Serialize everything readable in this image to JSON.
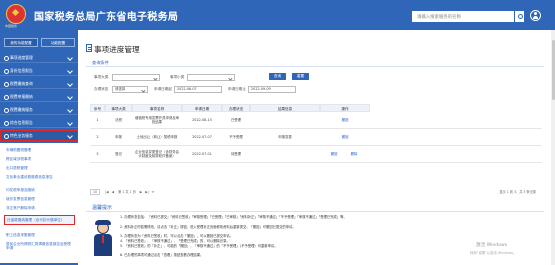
{
  "header": {
    "title": "国家税务总局广东省电子税务局",
    "logo_sub": "中国税务",
    "search_placeholder": "请输入搜索服务的名称"
  },
  "sidebar": {
    "tabs": [
      "我的功能配置",
      "功能配置"
    ],
    "items": [
      "事项进度管理",
      "身份信息报告",
      "税费缴纳查询",
      "税费申报缴纳",
      "税费缴纳服务",
      "综合信息报告",
      "特色业务服务"
    ],
    "highlighted_index": 6,
    "subitems": [
      "车辆购置税管理",
      "跨区域涉税事项",
      "出口退税管理",
      "文化事业建设费缴费信息报告",
      "印花税申报及缴纳",
      "境外发票信息管理",
      "非正常户解除申请",
      "社保费缴纳管理（含代扣代缴单位）",
      "职工信息采集管理",
      "居民企业所得税汇算清缴信息报告及受理申请"
    ],
    "active_subitem_index": 6
  },
  "main": {
    "page_title": "事项进度管理",
    "section_title": "查询条件",
    "filters": {
      "type_label": "事项大类",
      "type_value": "",
      "subtype_label": "事项小类",
      "subtype_value": "",
      "status_label": "办理状态",
      "status_value": "请选择",
      "start_label": "申请日期起",
      "start_value": "2022-06-07",
      "end_label": "申请日期止",
      "end_value": "2022-09-09"
    },
    "buttons": {
      "query": "查询",
      "reset": "重置"
    },
    "table": {
      "headers": [
        "序号",
        "事项大类",
        "事项名称",
        "申请日期",
        "办理状态",
        "结果信息",
        "操作"
      ],
      "rows": [
        {
          "no": "1",
          "category": "法税",
          "name": "增值税专用发票开具申请及审批结果",
          "date": "2022-08-15",
          "status": "已受理",
          "result": "",
          "actions": [
            "撤回"
          ]
        },
        {
          "no": "2",
          "category": "申报",
          "name": "土地出让（转让）契税申报",
          "date": "2022-07-07",
          "status": "不予受理",
          "result": "申报变更",
          "actions": [
            "撤回"
          ]
        },
        {
          "no": "3",
          "category": "登记",
          "name": "企业信息变更登记（含财务会计制度及核算软件备案）",
          "date": "2022-07-01",
          "status": "待受理",
          "result": "",
          "actions": [
            "撤回",
            "删除"
          ]
        }
      ]
    },
    "pager": {
      "page_size": "10",
      "page_text": "第 1 共 1 页",
      "summary": "显示 1 到 3，共 3 条记录"
    },
    "hint": {
      "title": "温馨提示",
      "lines": [
        "1. 办理状态包括：「资料已提交」「资料已签收」「审核受理」「已受理」「已审核」「资料补正」「审核不通过」「不予受理」「审核不通过」「受理已完成」等。",
        "2. 资料补正时若需修改，请点击「补正」按钮，进入受理补正页面修改资料后重新提交；「撤回」可撤回已提交的申请。",
        "3. 办理状态为「资料已签收」时，可以点击「撤回」，可以撤回已提交申请。",
        "4. 「资料已签收」、「审核不通过」、「受理已完成」的，可以删除记录。",
        "5. 「资料已签收」的「补正」、可能的「撤回」、「审核不通过」的「不予受理」（不予受理）可重新申请。",
        "6. 已办理的事项可通过点击「查看」按钮查看办理结果。"
      ]
    }
  },
  "watermark": {
    "line1": "激活 Windows",
    "line2": "转到\"设置\"以激活 Windows。"
  },
  "colors": {
    "brand": "#2f66b8",
    "highlight": "#e32626",
    "link": "#1d5fc7"
  }
}
